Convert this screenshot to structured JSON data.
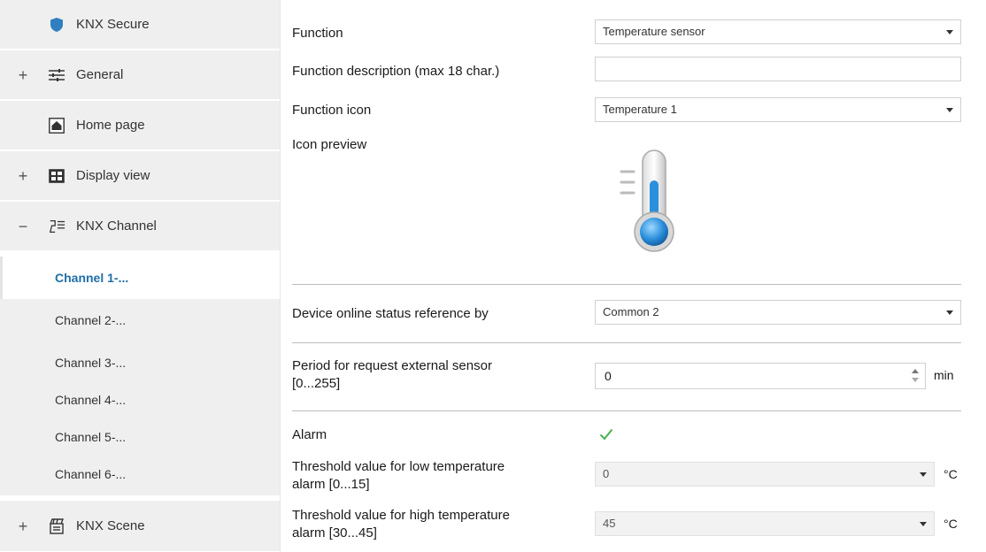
{
  "sidebar": {
    "items": [
      {
        "toggle": "",
        "icon": "shield-icon",
        "label": "KNX Secure"
      },
      {
        "toggle": "+",
        "icon": "sliders-icon",
        "label": "General"
      },
      {
        "toggle": "",
        "icon": "home-icon",
        "label": "Home page"
      },
      {
        "toggle": "+",
        "icon": "grid-view-icon",
        "label": "Display view"
      },
      {
        "toggle": "−",
        "icon": "knx-channel-icon",
        "label": "KNX Channel"
      }
    ],
    "channels": [
      "Channel 1-...",
      "Channel 2-...",
      "Channel 3-...",
      "Channel 4-...",
      "Channel 5-...",
      "Channel 6-..."
    ],
    "scene": {
      "toggle": "+",
      "icon": "scene-icon",
      "label": "KNX Scene"
    }
  },
  "form": {
    "function_label": "Function",
    "function_value": "Temperature sensor",
    "desc_label": "Function description (max 18 char.)",
    "desc_value": "",
    "icon_label": "Function icon",
    "icon_value": "Temperature 1",
    "preview_label": "Icon preview",
    "preview_icon": "thermometer-icon",
    "online_label": "Device online status reference by",
    "online_value": "Common 2",
    "period_label_1": "Period for request external sensor",
    "period_label_2": "[0...255]",
    "period_value": "0",
    "period_unit": "min",
    "alarm_label": "Alarm",
    "alarm_checked": true,
    "low_label_1": "Threshold value for low temperature",
    "low_label_2": "alarm [0...15]",
    "low_value": "0",
    "low_unit": "°C",
    "high_label_1": "Threshold value for high temperature",
    "high_label_2": "alarm [30...45]",
    "high_value": "45",
    "high_unit": "°C"
  },
  "colors": {
    "accent": "#1f6fa8",
    "sidebar_bg": "#efefef",
    "check": "#4caf50"
  }
}
